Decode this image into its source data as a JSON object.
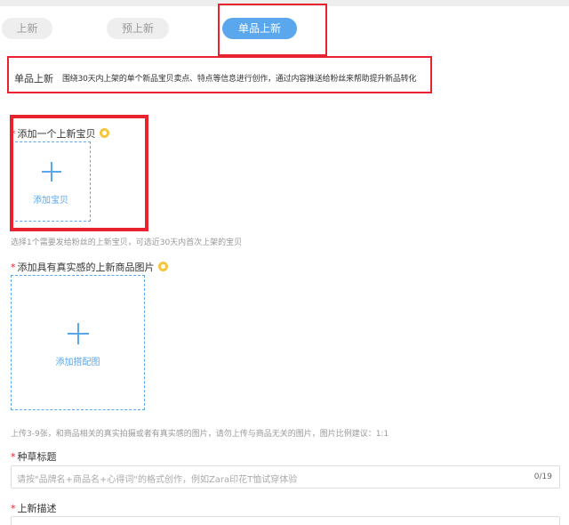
{
  "tabs": [
    {
      "label": "上新"
    },
    {
      "label": "预上新"
    },
    {
      "label": "单品上新"
    }
  ],
  "description": {
    "title": "单品上新",
    "text": "围绕30天内上架的单个新品宝贝卖点、特点等信息进行创作，通过内容推送给粉丝来帮助提升新品转化"
  },
  "item_section": {
    "required": "*",
    "label": "添加一个上新宝贝",
    "upload_label": "添加宝贝",
    "hint": "选择1个需要发给粉丝的上新宝贝，可选近30天内首次上架的宝贝"
  },
  "image_section": {
    "required": "*",
    "label": "添加具有真实感的上新商品图片",
    "upload_label": "添加搭配图",
    "hint": "上传3-9张，和商品相关的真实拍摄或者有真实感的图片，请勿上传与商品无关的图片，图片比例建议：1:1"
  },
  "title_section": {
    "required": "*",
    "label": "种草标题",
    "placeholder": "请按\"品牌名+商品名+心得词\"的格式创作，例如Zara印花T恤试穿体验",
    "counter": "0/19"
  },
  "description_section": {
    "required": "*",
    "label": "上新描述"
  },
  "colors": {
    "accent": "#5aa7ed",
    "highlight_border": "#e8232f",
    "badge": "#f4c63c"
  }
}
